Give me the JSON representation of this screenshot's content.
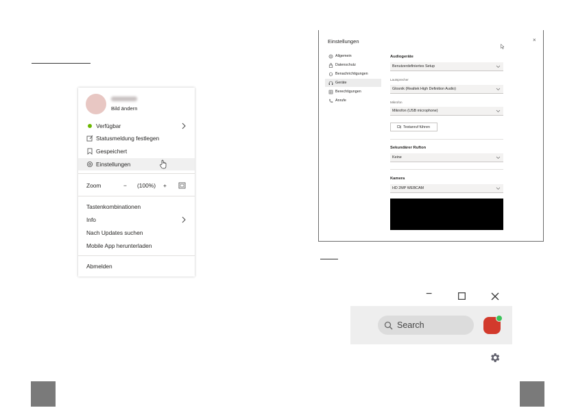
{
  "menu": {
    "picture_label": "Bild ändern",
    "status": "Verfügbar",
    "status_color": "#6bb700",
    "set_status_message": "Statusmeldung festlegen",
    "saved": "Gespeichert",
    "settings": "Einstellungen",
    "zoom_label": "Zoom",
    "zoom_minus": "−",
    "zoom_value": "(100%)",
    "zoom_plus": "+",
    "shortcuts": "Tastenkombinationen",
    "info": "Info",
    "check_updates": "Nach Updates suchen",
    "mobile_app": "Mobile App herunterladen",
    "sign_out": "Abmelden"
  },
  "settings_dialog": {
    "title": "Einstellungen",
    "close": "×",
    "nav": [
      {
        "label": "Allgemein",
        "icon": "gear-icon"
      },
      {
        "label": "Datenschutz",
        "icon": "lock-icon"
      },
      {
        "label": "Benachrichtigungen",
        "icon": "bell-icon"
      },
      {
        "label": "Geräte",
        "icon": "headset-icon"
      },
      {
        "label": "Berechtigungen",
        "icon": "grid-icon"
      },
      {
        "label": "Anrufe",
        "icon": "phone-icon"
      }
    ],
    "audio_heading": "Audiogeräte",
    "audio_value": "Benutzerdefiniertes Setup",
    "speaker_label": "Lautsprecher",
    "speaker_value": "Glosnik (Realtek High Definition Audio)",
    "mic_label": "Mikrofon",
    "mic_value": "Mikrofon (USB microphone)",
    "test_call": "Testanruf führen",
    "secondary_ring_heading": "Sekundärer Rufton",
    "secondary_ring_value": "Keine",
    "camera_heading": "Kamera",
    "camera_value": "HD 2MP WEBCAM"
  },
  "zoom_window": {
    "minimize": "−",
    "maximize": "☐",
    "close": "✕",
    "search_placeholder": "Search",
    "presence_color": "#3cc35a",
    "avatar_color": "#d23a2c"
  }
}
